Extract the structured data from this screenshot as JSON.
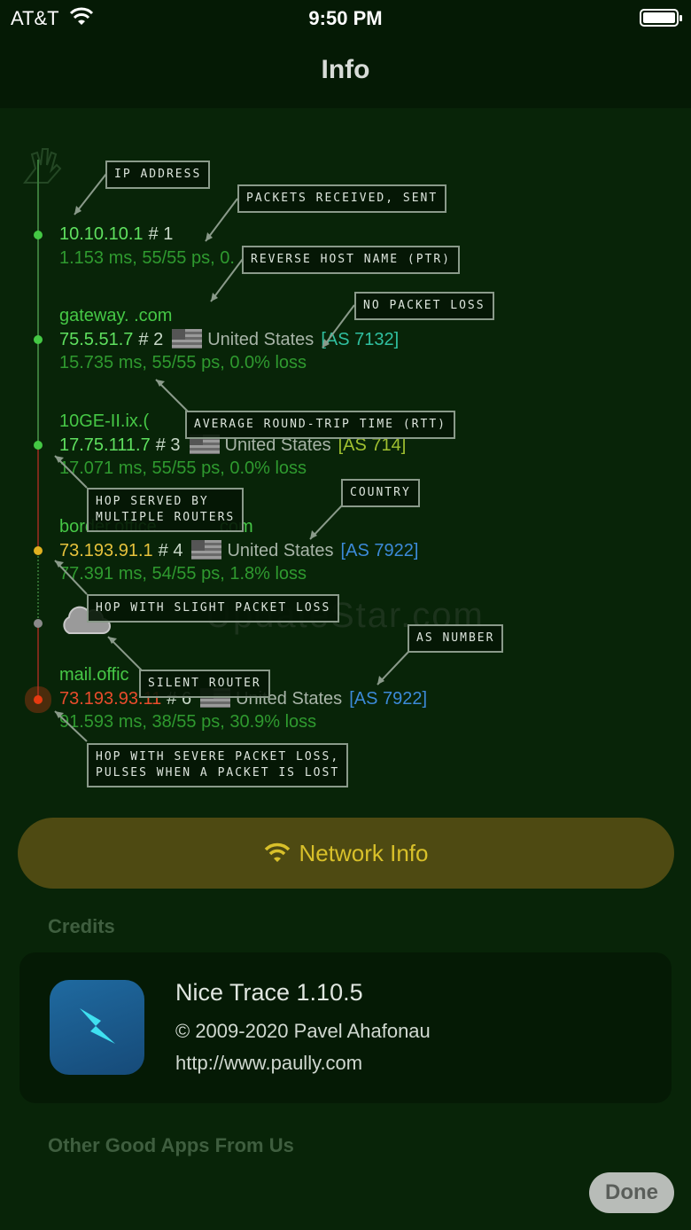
{
  "status_bar": {
    "carrier": "AT&T",
    "time": "9:50 PM"
  },
  "nav": {
    "title": "Info"
  },
  "hops": [
    {
      "host": "",
      "ip": "10.10.10.1",
      "index": "# 1",
      "country": "",
      "as": "",
      "stats": "1.153 ms, 55/55 ps, 0."
    },
    {
      "host": "gateway. .com",
      "ip": "75.5.51.7",
      "index": "# 2",
      "country": "United States",
      "as": "[AS 7132]",
      "stats": "15.735 ms, 55/55 ps, 0.0% loss"
    },
    {
      "host": "10GE-II.ix.(",
      "ip": "17.75.111.7",
      "index": "# 3",
      "country": "United States",
      "as": "[AS 714]",
      "stats": "17.071 ms, 55/55 ps, 0.0% loss"
    },
    {
      "host": "border.office.",
      "host_tail": ".com",
      "ip": "73.193.91.1",
      "index": "# 4",
      "country": "United States",
      "as": "[AS 7922]",
      "stats": "77.391 ms, 54/55 ps, 1.8% loss"
    },
    {
      "host": "mail.offic",
      "ip": "73.193.93.11",
      "index": "# 6",
      "country": "United States",
      "as": "[AS 7922]",
      "stats": "91.593 ms, 38/55 ps, 30.9% loss"
    }
  ],
  "labels": {
    "ip_address": "IP ADDRESS",
    "packets": "PACKETS RECEIVED, SENT",
    "ptr": "REVERSE HOST NAME (PTR)",
    "no_loss": "NO PACKET LOSS",
    "rtt": "AVERAGE ROUND-TRIP TIME (RTT)",
    "multiple_routers_1": "HOP SERVED BY",
    "multiple_routers_2": "MULTIPLE ROUTERS",
    "country": "COUNTRY",
    "slight_loss": "HOP WITH SLIGHT PACKET LOSS",
    "as_number": "AS NUMBER",
    "silent_router": "SILENT ROUTER",
    "severe_1": "HOP WITH SEVERE PACKET LOSS,",
    "severe_2": "PULSES WHEN A PACKET IS LOST"
  },
  "watermark": "UpdateStar.com",
  "network_button": {
    "label": "Network Info"
  },
  "sections": {
    "credits": "Credits",
    "other_apps": "Other Good Apps From Us"
  },
  "credits": {
    "app_name": "Nice Trace 1.10.5",
    "copyright": "© 2009-2020 Pavel Ahafonau",
    "url": "http://www.paully.com"
  },
  "done_button": {
    "label": "Done"
  },
  "colors": {
    "background": "#082408",
    "accent_green": "#46c846",
    "network_button_bg": "#4e4a12",
    "network_button_text": "#d8c02a"
  }
}
